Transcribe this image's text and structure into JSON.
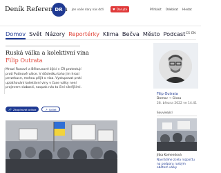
{
  "header": {
    "brand": "Deník Referendum",
    "logo_text": "DR",
    "promo": "Jen vaše dary nás drží",
    "donate_label": "Darujte",
    "links": [
      "Přihlásit",
      "Odebírat",
      "Hledat"
    ]
  },
  "nav": {
    "items": [
      "Domov",
      "Svět",
      "Názory",
      "Reportérky",
      "Klima",
      "Bečva",
      "Město",
      "Podcast"
    ],
    "lang_cs": "CS",
    "lang_en": "EN"
  },
  "article": {
    "title": "Ruská válka a kolektivní vina",
    "author": "Filip Outrata",
    "perex": "Mnozí Rusové a Bělorusové žijící v ČR protestují proti Putinově válce. V důsledku toho jim hrozí perzekuce, mohou přijít o víza. Vystupovat proti uplatňování kolektivní viny v čase války není projevem slabosti, naopak nás to činí silnějšími.",
    "chips": [
      "Zkopírovat odkaz",
      "Sdílet"
    ]
  },
  "sidebar": {
    "author": "Filip Outrata",
    "category": "Domov → Glosa",
    "date": "28. března 2022 ve 14.41",
    "related_heading": "Související",
    "card_author": "Jitka Komendová",
    "card_text": "Navrátíme zcela rozpočtu na podporu ruským obětem války"
  },
  "colors": {
    "brand_blue": "#1f3a93",
    "accent_red": "#e0463a"
  }
}
